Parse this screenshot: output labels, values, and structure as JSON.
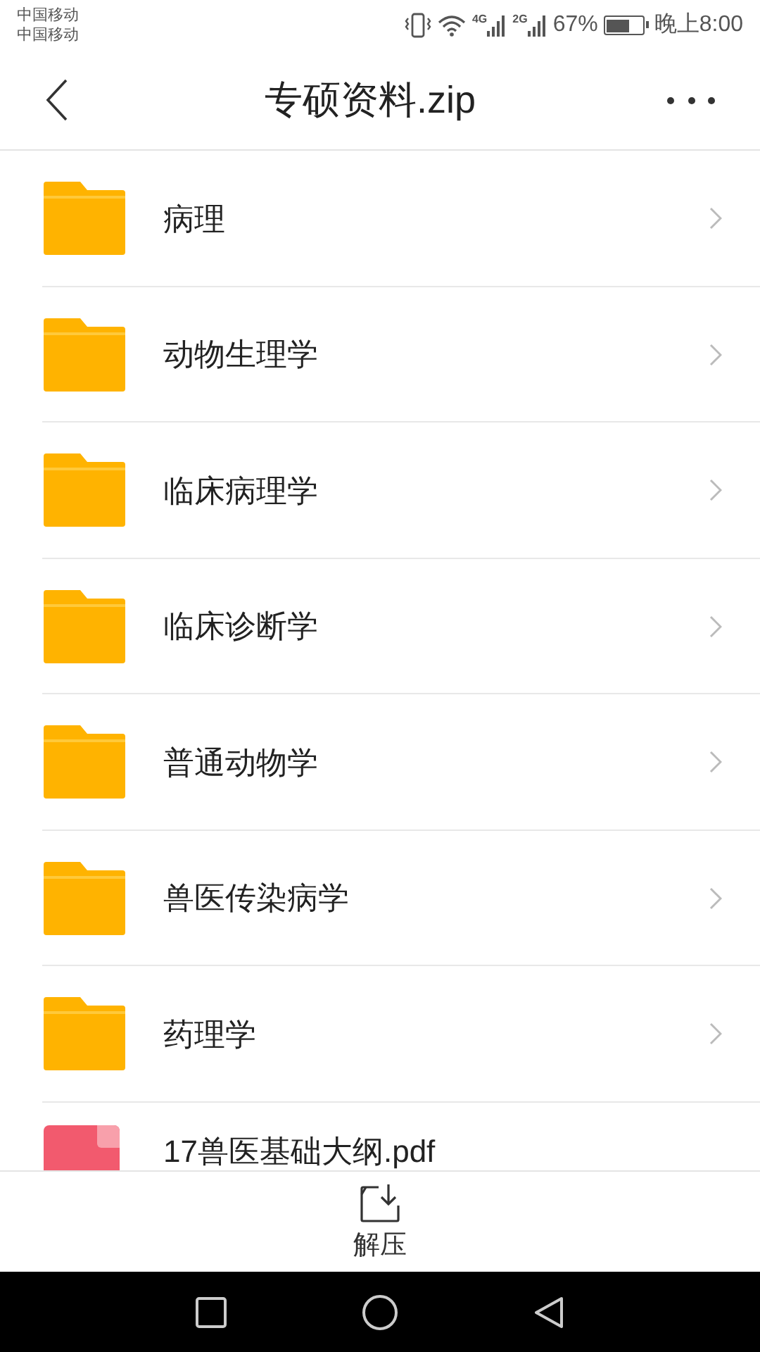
{
  "status_bar": {
    "carriers": [
      "中国移动",
      "中国移动"
    ],
    "network_1": "4G",
    "network_2": "2G",
    "battery": "67%",
    "time": "晚上8:00"
  },
  "header": {
    "title": "专硕资料.zip"
  },
  "items": [
    {
      "kind": "folder",
      "name": "病理"
    },
    {
      "kind": "folder",
      "name": "动物生理学"
    },
    {
      "kind": "folder",
      "name": "临床病理学"
    },
    {
      "kind": "folder",
      "name": "临床诊断学"
    },
    {
      "kind": "folder",
      "name": "普通动物学"
    },
    {
      "kind": "folder",
      "name": "兽医传染病学"
    },
    {
      "kind": "folder",
      "name": "药理学"
    },
    {
      "kind": "pdf",
      "name": "17兽医基础大纲.pdf"
    }
  ],
  "bottom_action": {
    "label": "解压"
  }
}
